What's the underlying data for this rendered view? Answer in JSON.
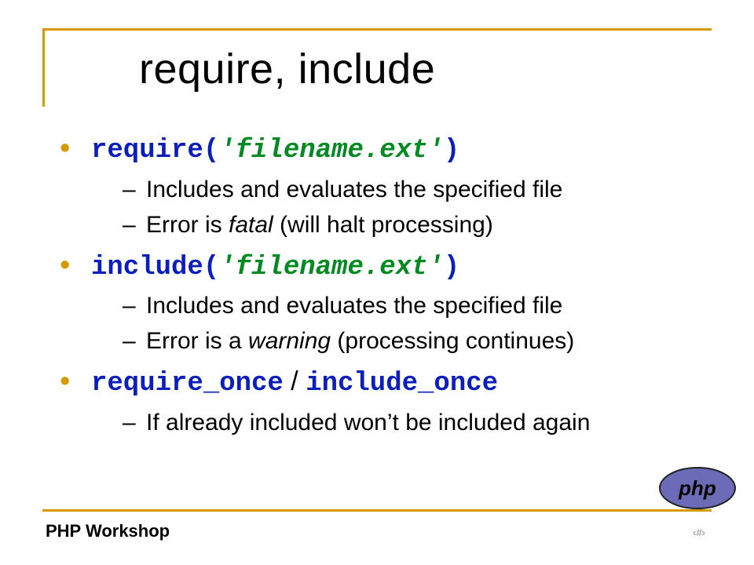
{
  "title": "require, include",
  "bullets": {
    "b1": {
      "fn": "require(",
      "arg": "'filename.ext'",
      "close": ")",
      "sub1": "Includes and evaluates the specified file",
      "sub2_a": "Error is ",
      "sub2_em": "fatal",
      "sub2_b": " (will halt processing)"
    },
    "b2": {
      "fn": "include(",
      "arg": "'filename.ext'",
      "close": ")",
      "sub1": "Includes and evaluates the specified file",
      "sub2_a": "Error is a ",
      "sub2_em": "warning",
      "sub2_b": " (processing continues)"
    },
    "b3": {
      "fn1": "require_once",
      "sep": " / ",
      "fn2": "include_once",
      "sub1": "If already included won’t be included again"
    }
  },
  "footer": {
    "left": "PHP Workshop",
    "right": "‹#›"
  },
  "logo": {
    "text": "php"
  }
}
